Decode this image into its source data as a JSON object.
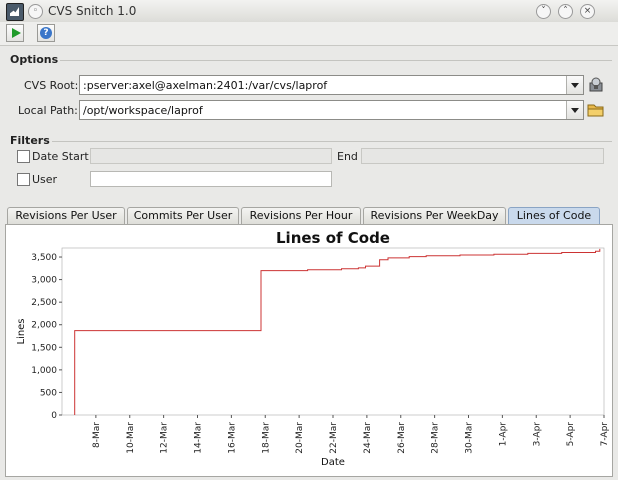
{
  "window": {
    "title": "CVS Snitch 1.0"
  },
  "options": {
    "title": "Options",
    "cvs_root_label": "CVS Root:",
    "cvs_root_value": ":pserver:axel@axelman:2401:/var/cvs/laprof",
    "local_path_label": "Local Path:",
    "local_path_value": "/opt/workspace/laprof"
  },
  "filters": {
    "title": "Filters",
    "date_start_label": "Date Start",
    "end_label": "End",
    "user_label": "User"
  },
  "tabs": [
    {
      "label": "Revisions Per User",
      "active": false
    },
    {
      "label": "Commits Per User",
      "active": false
    },
    {
      "label": "Revisions Per Hour",
      "active": false
    },
    {
      "label": "Revisions Per WeekDay",
      "active": false
    },
    {
      "label": "Lines of Code",
      "active": true
    }
  ],
  "colors": {
    "series": "#cc3333",
    "active_tab": "#c9d9ec"
  },
  "icons": [
    "run-icon",
    "help-icon",
    "combo-arrow-icon",
    "cvs-connect-icon",
    "folder-icon"
  ],
  "chart_data": {
    "type": "line",
    "title": "Lines of Code",
    "xlabel": "Date",
    "ylabel": "Lines",
    "x_start": "2005-03-06",
    "x_end": "2005-04-07",
    "ylim": [
      0,
      3700
    ],
    "yticks": [
      0,
      500,
      1000,
      1500,
      2000,
      2500,
      3000,
      3500
    ],
    "ytick_labels": [
      "0",
      "500",
      "1,000",
      "1,500",
      "2,000",
      "2,500",
      "3,000",
      "3,500"
    ],
    "xticks": [
      "2005-03-08",
      "2005-03-10",
      "2005-03-12",
      "2005-03-14",
      "2005-03-16",
      "2005-03-18",
      "2005-03-20",
      "2005-03-22",
      "2005-03-24",
      "2005-03-26",
      "2005-03-28",
      "2005-03-30",
      "2005-04-01",
      "2005-04-03",
      "2005-04-05",
      "2005-04-07"
    ],
    "xtick_labels": [
      "8-Mar",
      "10-Mar",
      "12-Mar",
      "14-Mar",
      "16-Mar",
      "18-Mar",
      "20-Mar",
      "22-Mar",
      "24-Mar",
      "26-Mar",
      "28-Mar",
      "30-Mar",
      "1-Apr",
      "3-Apr",
      "5-Apr",
      "7-Apr"
    ],
    "grid": false,
    "series": [
      {
        "step": true,
        "points": [
          [
            "2005-03-06T18:00",
            0
          ],
          [
            "2005-03-06T18:00",
            1870
          ],
          [
            "2005-03-17T18:00",
            1870
          ],
          [
            "2005-03-17T18:00",
            3200
          ],
          [
            "2005-03-20T12:00",
            3220
          ],
          [
            "2005-03-22T12:00",
            3240
          ],
          [
            "2005-03-23T12:00",
            3260
          ],
          [
            "2005-03-23T22:00",
            3300
          ],
          [
            "2005-03-24T18:00",
            3440
          ],
          [
            "2005-03-25T06:00",
            3480
          ],
          [
            "2005-03-26T12:00",
            3510
          ],
          [
            "2005-03-27T12:00",
            3530
          ],
          [
            "2005-03-29T12:00",
            3545
          ],
          [
            "2005-03-31T12:00",
            3560
          ],
          [
            "2005-04-02T12:00",
            3580
          ],
          [
            "2005-04-04T12:00",
            3600
          ],
          [
            "2005-04-06T12:00",
            3630
          ],
          [
            "2005-04-06T18:00",
            3680
          ]
        ]
      }
    ]
  }
}
